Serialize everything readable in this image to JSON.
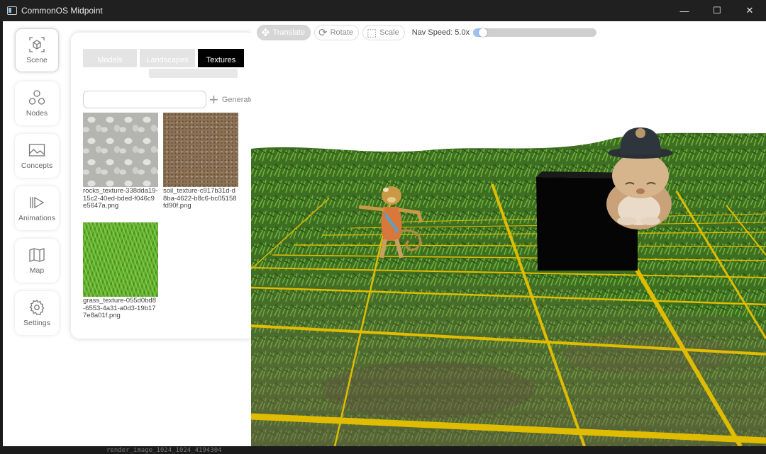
{
  "window": {
    "title": "CommonOS Midpoint",
    "controls": {
      "minimize": "—",
      "maximize": "☐",
      "close": "✕"
    }
  },
  "terminal_text": "render_image_1024_1024_4194304",
  "sidebar": {
    "items": [
      {
        "label": "Scene",
        "icon": "cube-icon",
        "active": true
      },
      {
        "label": "Nodes",
        "icon": "nodes-icon",
        "active": false
      },
      {
        "label": "Concepts",
        "icon": "image-icon",
        "active": false
      },
      {
        "label": "Animations",
        "icon": "animation-icon",
        "active": false
      },
      {
        "label": "Map",
        "icon": "map-icon",
        "active": false
      },
      {
        "label": "Settings",
        "icon": "gear-icon",
        "active": false
      }
    ]
  },
  "panel": {
    "tabs": [
      {
        "label": "Models",
        "active": false
      },
      {
        "label": "Landscapes",
        "active": false
      },
      {
        "label": "Textures",
        "active": true
      }
    ],
    "generate": {
      "input_value": "",
      "button_label": "Generate"
    },
    "textures": [
      {
        "file": "rocks_texture-338dda19-15c2-40ed-bded-f046c9e5647a.png",
        "kind": "rocks"
      },
      {
        "file": "soil_texture-c917b31d-d8ba-4622-b8c6-bc05158fd90f.png",
        "kind": "soil"
      },
      {
        "file": "grass_texture-055d0bd8-6553-4a31-a0d3-19b177e8a01f.png",
        "kind": "grass"
      }
    ]
  },
  "toolbar": {
    "translate": "Translate",
    "rotate": "Rotate",
    "scale": "Scale",
    "active_tool": "Translate",
    "nav_speed_label": "Nav Speed: 5.0x",
    "nav_speed_fraction": 0.05
  },
  "colors": {
    "grid": "#e8c400",
    "grass_dark": "#2f5a1a",
    "grass_light": "#5c9a2e",
    "selection": "#9ec2f2"
  }
}
